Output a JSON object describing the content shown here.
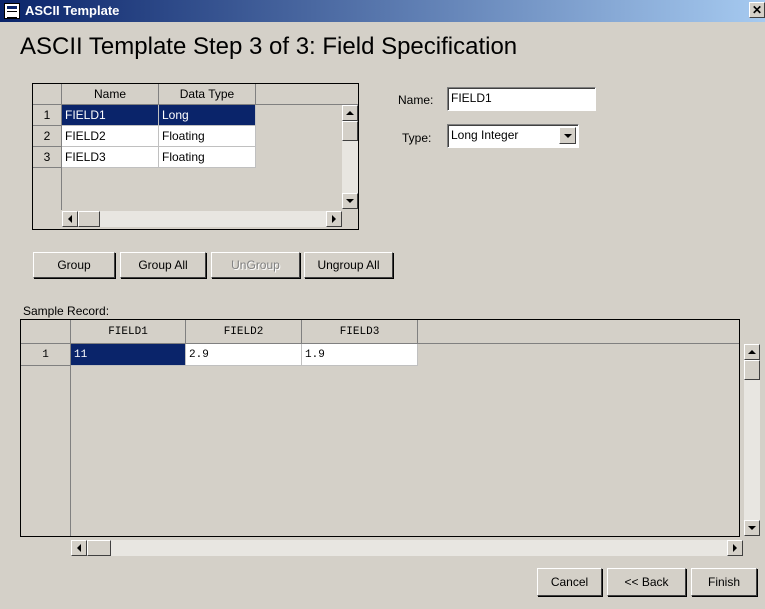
{
  "window": {
    "title": "ASCII Template",
    "close_glyph": "✕"
  },
  "heading": "ASCII Template Step 3 of 3:  Field Specification",
  "field_grid": {
    "columns": [
      "Name",
      "Data Type"
    ],
    "rows": [
      {
        "num": "1",
        "name": "FIELD1",
        "type": "Long"
      },
      {
        "num": "2",
        "name": "FIELD2",
        "type": "Floating"
      },
      {
        "num": "3",
        "name": "FIELD3",
        "type": "Floating"
      }
    ],
    "selected_row": 1
  },
  "name_field": {
    "label": "Name:",
    "value": "FIELD1"
  },
  "type_field": {
    "label": "Type:",
    "value": "Long Integer"
  },
  "group_buttons": {
    "group": "Group",
    "group_all": "Group All",
    "ungroup": "UnGroup",
    "ungroup_all": "Ungroup All"
  },
  "sample": {
    "label": "Sample Record:",
    "columns": [
      "FIELD1",
      "FIELD2",
      "FIELD3"
    ],
    "rows": [
      {
        "num": "1",
        "values": [
          "11",
          "2.9",
          "1.9"
        ]
      }
    ]
  },
  "footer": {
    "cancel": "Cancel",
    "back": "<< Back",
    "finish": "Finish"
  },
  "colors": {
    "selection": "#0a246a",
    "face": "#d4d0c8",
    "title_start": "#0a246a"
  }
}
